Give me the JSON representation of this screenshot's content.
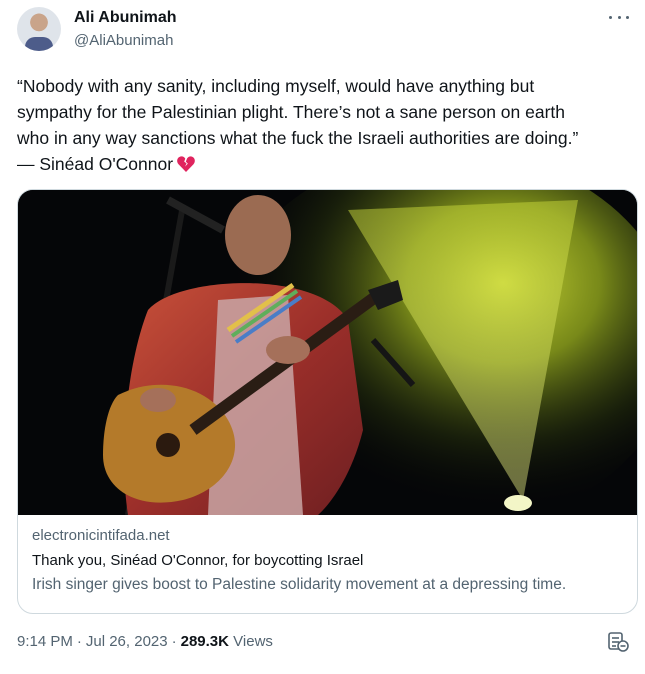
{
  "author": {
    "display_name": "Ali Abunimah",
    "handle": "@AliAbunimah"
  },
  "tweet": {
    "text": "“Nobody with any sanity, including myself, would have anything but\nsympathy for the Palestinian plight. There’s not a sane person on earth\nwho in any way sanctions what the fuck the Israeli authorities are doing.”\n— Sinéad O'Connor",
    "emoji_icon": "broken-heart-icon"
  },
  "card": {
    "domain": "electronicintifada.net",
    "title": "Thank you, Sinéad O'Connor, for boycotting Israel",
    "description": "Irish singer gives boost to Palestine solidarity movement at a depressing time."
  },
  "footer": {
    "time": "9:14 PM",
    "date": "Jul 26, 2023",
    "views_count": "289.3K",
    "views_label": "Views",
    "separator": "·"
  },
  "colors": {
    "text_primary": "#0f1419",
    "text_secondary": "#536471",
    "border": "#cfd9de",
    "heart": "#e0245e"
  }
}
